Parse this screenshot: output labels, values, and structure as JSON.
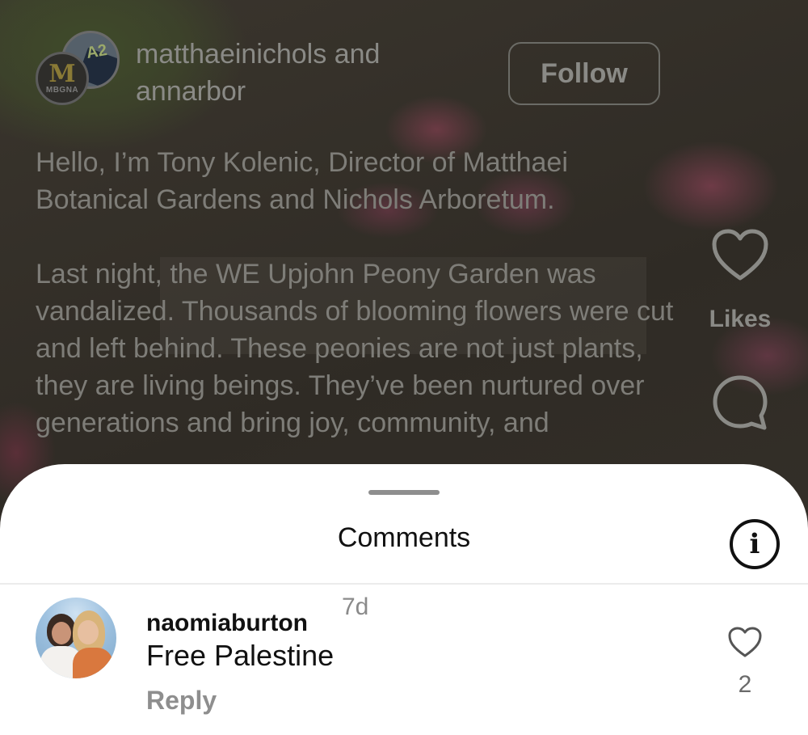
{
  "post": {
    "author_primary": "matthaeinichols",
    "author_connector": "and",
    "author_secondary": "annarbor",
    "avatar_front_letter": "M",
    "avatar_front_subtext": "MBGNA",
    "avatar_back_text": "A2",
    "follow_label": "Follow",
    "caption_paragraph_1": "Hello, I’m Tony Kolenic, Director of Matthaei Botanical Gardens and Nichols Arboretum.",
    "caption_paragraph_2": "Last night, the WE Upjohn Peony Garden was vandalized. Thousands of blooming flowers were cut and left behind. These peonies are not just plants, they are living beings. They’ve been nurtured over generations and bring joy, community, and",
    "likes_label": "Likes"
  },
  "comments_sheet": {
    "title": "Comments",
    "info_symbol": "i",
    "comments": [
      {
        "username": "naomiaburton",
        "time": "7d",
        "text": "Free Palestine",
        "reply_label": "Reply",
        "like_count": "2"
      }
    ]
  },
  "icons": {
    "side_like": "heart-icon",
    "side_comment": "comment-bubble-icon",
    "info": "info-icon",
    "comment_like": "heart-icon"
  }
}
